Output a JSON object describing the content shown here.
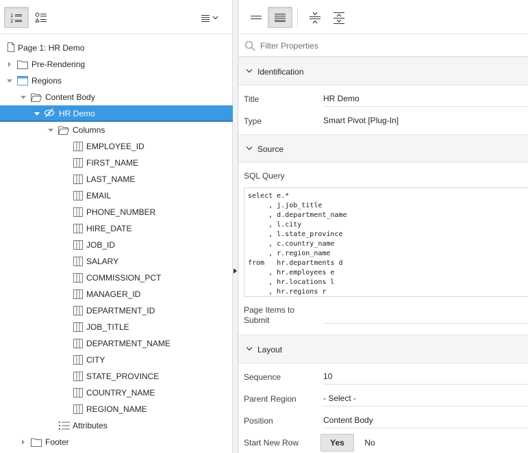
{
  "tree": {
    "page": "Page 1: HR Demo",
    "pre_rendering": "Pre-Rendering",
    "regions": "Regions",
    "content_body": "Content Body",
    "hr_demo": "HR Demo",
    "columns_folder": "Columns",
    "columns": [
      "EMPLOYEE_ID",
      "FIRST_NAME",
      "LAST_NAME",
      "EMAIL",
      "PHONE_NUMBER",
      "HIRE_DATE",
      "JOB_ID",
      "SALARY",
      "COMMISSION_PCT",
      "MANAGER_ID",
      "DEPARTMENT_ID",
      "JOB_TITLE",
      "DEPARTMENT_NAME",
      "CITY",
      "STATE_PROVINCE",
      "COUNTRY_NAME",
      "REGION_NAME"
    ],
    "attributes": "Attributes",
    "footer": "Footer"
  },
  "filter": {
    "placeholder": "Filter Properties"
  },
  "identification": {
    "group": "Identification",
    "title_label": "Title",
    "title_value": "HR Demo",
    "type_label": "Type",
    "type_value": "Smart Pivot [Plug-In]"
  },
  "source": {
    "group": "Source",
    "sql_label": "SQL Query",
    "sql": "select e.*\n     , j.job_title\n     , d.department_name\n     , l.city\n     , l.state_province\n     , c.country_name\n     , r.region_name\nfrom   hr.departments d\n     , hr.employees e\n     , hr.locations l\n     , hr.regions r",
    "page_items_label": "Page Items to Submit",
    "page_items_value": ""
  },
  "layout": {
    "group": "Layout",
    "sequence_label": "Sequence",
    "sequence_value": "10",
    "parent_label": "Parent Region",
    "parent_value": "- Select -",
    "position_label": "Position",
    "position_value": "Content Body",
    "new_row_label": "Start New Row",
    "yes": "Yes",
    "no": "No"
  },
  "colors": {
    "selection": "#3b99e0",
    "accent_icon": "#5b9bd5"
  }
}
